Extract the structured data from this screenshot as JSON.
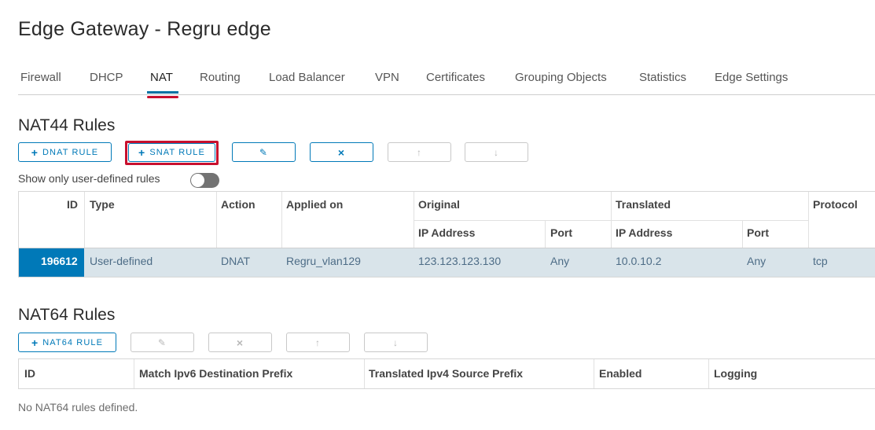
{
  "page": {
    "title": "Edge Gateway - Regru edge"
  },
  "tabs": [
    {
      "label": "Firewall"
    },
    {
      "label": "DHCP"
    },
    {
      "label": "NAT"
    },
    {
      "label": "Routing"
    },
    {
      "label": "Load Balancer"
    },
    {
      "label": "VPN"
    },
    {
      "label": "Certificates"
    },
    {
      "label": "Grouping Objects"
    },
    {
      "label": "Statistics"
    },
    {
      "label": "Edge Settings"
    }
  ],
  "active_tab": "NAT",
  "nat44": {
    "title": "NAT44 Rules",
    "buttons": {
      "dnat": "DNAT RULE",
      "snat": "SNAT RULE"
    },
    "toggle_label": "Show only user-defined rules",
    "toggle_on": false,
    "headers": {
      "id": "ID",
      "type": "Type",
      "action": "Action",
      "applied_on": "Applied on",
      "original": "Original",
      "translated": "Translated",
      "protocol": "Protocol",
      "orig_ip": "IP Address",
      "orig_port": "Port",
      "trans_ip": "IP Address",
      "trans_port": "Port"
    },
    "rows": [
      {
        "id": "196612",
        "type": "User-defined",
        "action": "DNAT",
        "applied_on": "Regru_vlan129",
        "orig_ip": "123.123.123.130",
        "orig_port": "Any",
        "trans_ip": "10.0.10.2",
        "trans_port": "Any",
        "protocol": "tcp"
      }
    ]
  },
  "nat64": {
    "title": "NAT64 Rules",
    "buttons": {
      "add": "NAT64 RULE"
    },
    "headers": {
      "id": "ID",
      "match": "Match Ipv6 Destination Prefix",
      "translated": "Translated Ipv4 Source Prefix",
      "enabled": "Enabled",
      "logging": "Logging"
    },
    "empty_text": "No NAT64 rules defined."
  },
  "colors": {
    "accent": "#0079b8",
    "highlight": "#c8102e",
    "selected_row": "#d9e4ea"
  }
}
